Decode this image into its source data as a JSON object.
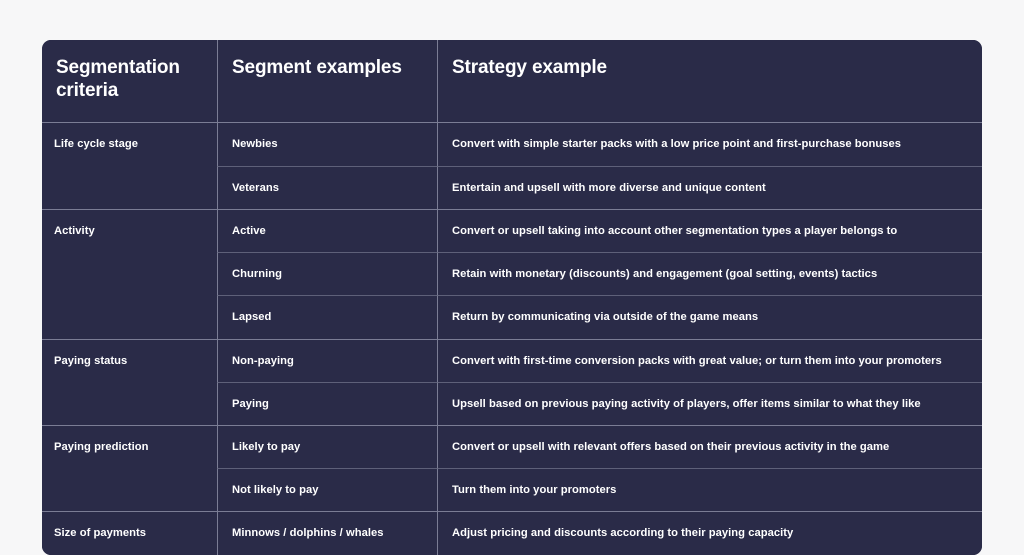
{
  "theme": {
    "page_background": "#f7f7f8",
    "table_background": "#2a2b48",
    "text_color": "#ffffff",
    "major_rule_color": "#7b7d95",
    "minor_rule_color": "#5e6079"
  },
  "table": {
    "headers": {
      "criteria": "Segmentation criteria",
      "segment": "Segment examples",
      "strategy": "Strategy example"
    },
    "groups": [
      {
        "criteria": "Life cycle stage",
        "rows": [
          {
            "segment": "Newbies",
            "strategy": "Convert with simple starter packs with a low price point and first-purchase bonuses"
          },
          {
            "segment": "Veterans",
            "strategy": "Entertain and upsell with more diverse and unique content"
          }
        ]
      },
      {
        "criteria": "Activity",
        "rows": [
          {
            "segment": "Active",
            "strategy": "Convert or upsell taking into account other segmentation types a player belongs to"
          },
          {
            "segment": "Churning",
            "strategy": "Retain with monetary (discounts) and engagement (goal setting, events) tactics"
          },
          {
            "segment": "Lapsed",
            "strategy": "Return by communicating via outside of the game means"
          }
        ]
      },
      {
        "criteria": "Paying status",
        "rows": [
          {
            "segment": "Non-paying",
            "strategy": "Convert with first-time conversion packs with great value; or turn them into your promoters"
          },
          {
            "segment": "Paying",
            "strategy": "Upsell based on previous paying activity of players, offer items similar to what they like"
          }
        ]
      },
      {
        "criteria": "Paying prediction",
        "rows": [
          {
            "segment": "Likely to pay",
            "strategy": "Convert or upsell with relevant offers based on their previous activity in the game"
          },
          {
            "segment": "Not likely to pay",
            "strategy": "Turn them into your promoters"
          }
        ]
      },
      {
        "criteria": "Size of payments",
        "rows": [
          {
            "segment": "Minnows / dolphins / whales",
            "strategy": "Adjust pricing and discounts according to their paying capacity"
          }
        ]
      }
    ]
  }
}
